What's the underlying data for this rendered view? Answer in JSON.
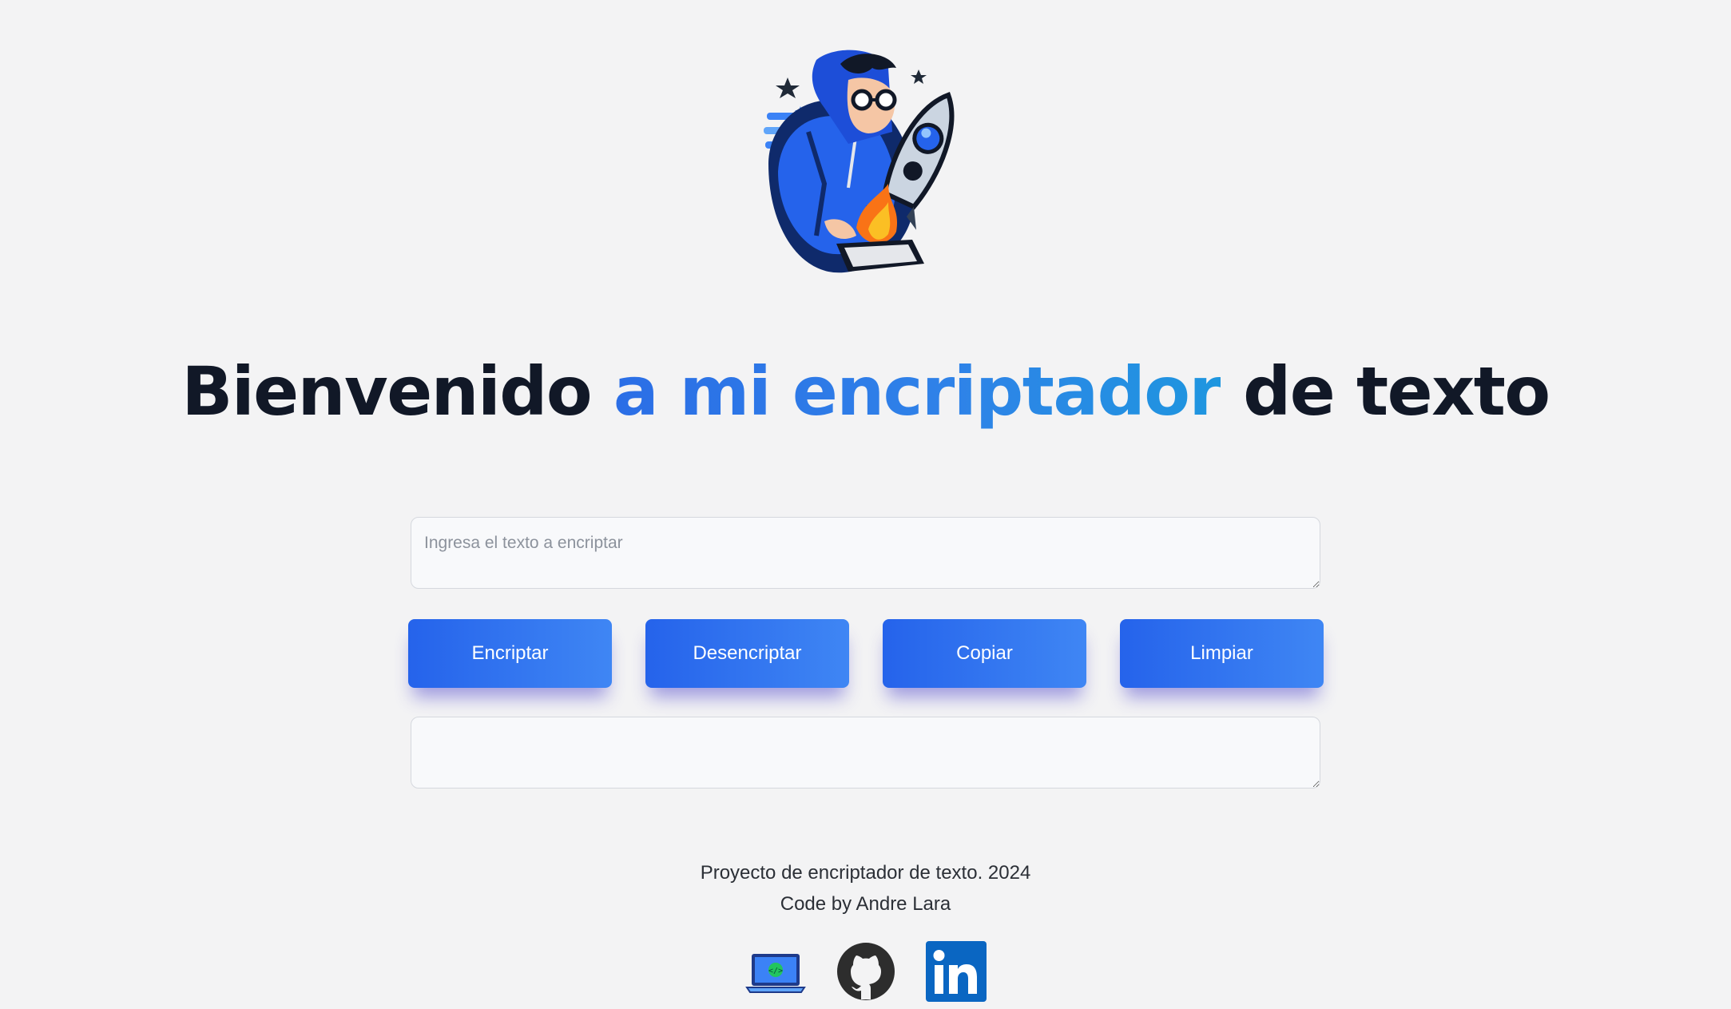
{
  "header": {
    "title_part1": "Bienvenido ",
    "title_accent": "a mi encriptador",
    "title_part2": " de texto"
  },
  "input": {
    "placeholder": "Ingresa el texto a encriptar",
    "value": ""
  },
  "buttons": {
    "encrypt_label": "Encriptar",
    "decrypt_label": "Desencriptar",
    "copy_label": "Copiar",
    "clear_label": "Limpiar"
  },
  "output": {
    "value": ""
  },
  "footer": {
    "line1": "Proyecto de encriptador de texto. 2024",
    "line2": "Code by Andre Lara"
  },
  "social_icons": [
    "portfolio-laptop-icon",
    "github-icon",
    "linkedin-icon"
  ],
  "colors": {
    "background": "#f3f3f4",
    "title_dark": "#111827",
    "accent_blue": "#2f82e8",
    "button_start": "#2563eb",
    "button_end": "#3f86f4",
    "linkedin": "#0a66c2",
    "github": "#2d2d2d"
  }
}
